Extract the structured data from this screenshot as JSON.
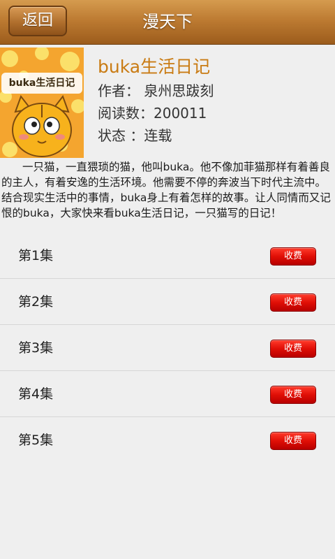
{
  "header": {
    "back_label": "返回",
    "app_title": "漫天下"
  },
  "comic": {
    "title": "buka生活日记",
    "cover_text": "buka生活日记",
    "author_label": "作者：",
    "author": "泉州思跋刻",
    "views_label": "阅读数：",
    "views": "200011",
    "status_label": "状态 ：",
    "status": "连载",
    "description": "一只猫，一直猥琐的猫，他叫buka。他不像加菲猫那样有着善良的主人，有着安逸的生活环境。他需要不停的奔波当下时代主流中。结合现实生活中的事情，buka身上有着怎样的故事。让人同情而又记恨的buka，大家快来看buka生活日记，一只猫写的日记！"
  },
  "episodes": [
    {
      "label": "第1集",
      "fee": "收费"
    },
    {
      "label": "第2集",
      "fee": "收费"
    },
    {
      "label": "第3集",
      "fee": "收费"
    },
    {
      "label": "第4集",
      "fee": "收费"
    },
    {
      "label": "第5集",
      "fee": "收费"
    }
  ],
  "colors": {
    "header": "#b97730",
    "title": "#c97b13",
    "fee_button": "#e00f06",
    "background": "#efefef"
  }
}
